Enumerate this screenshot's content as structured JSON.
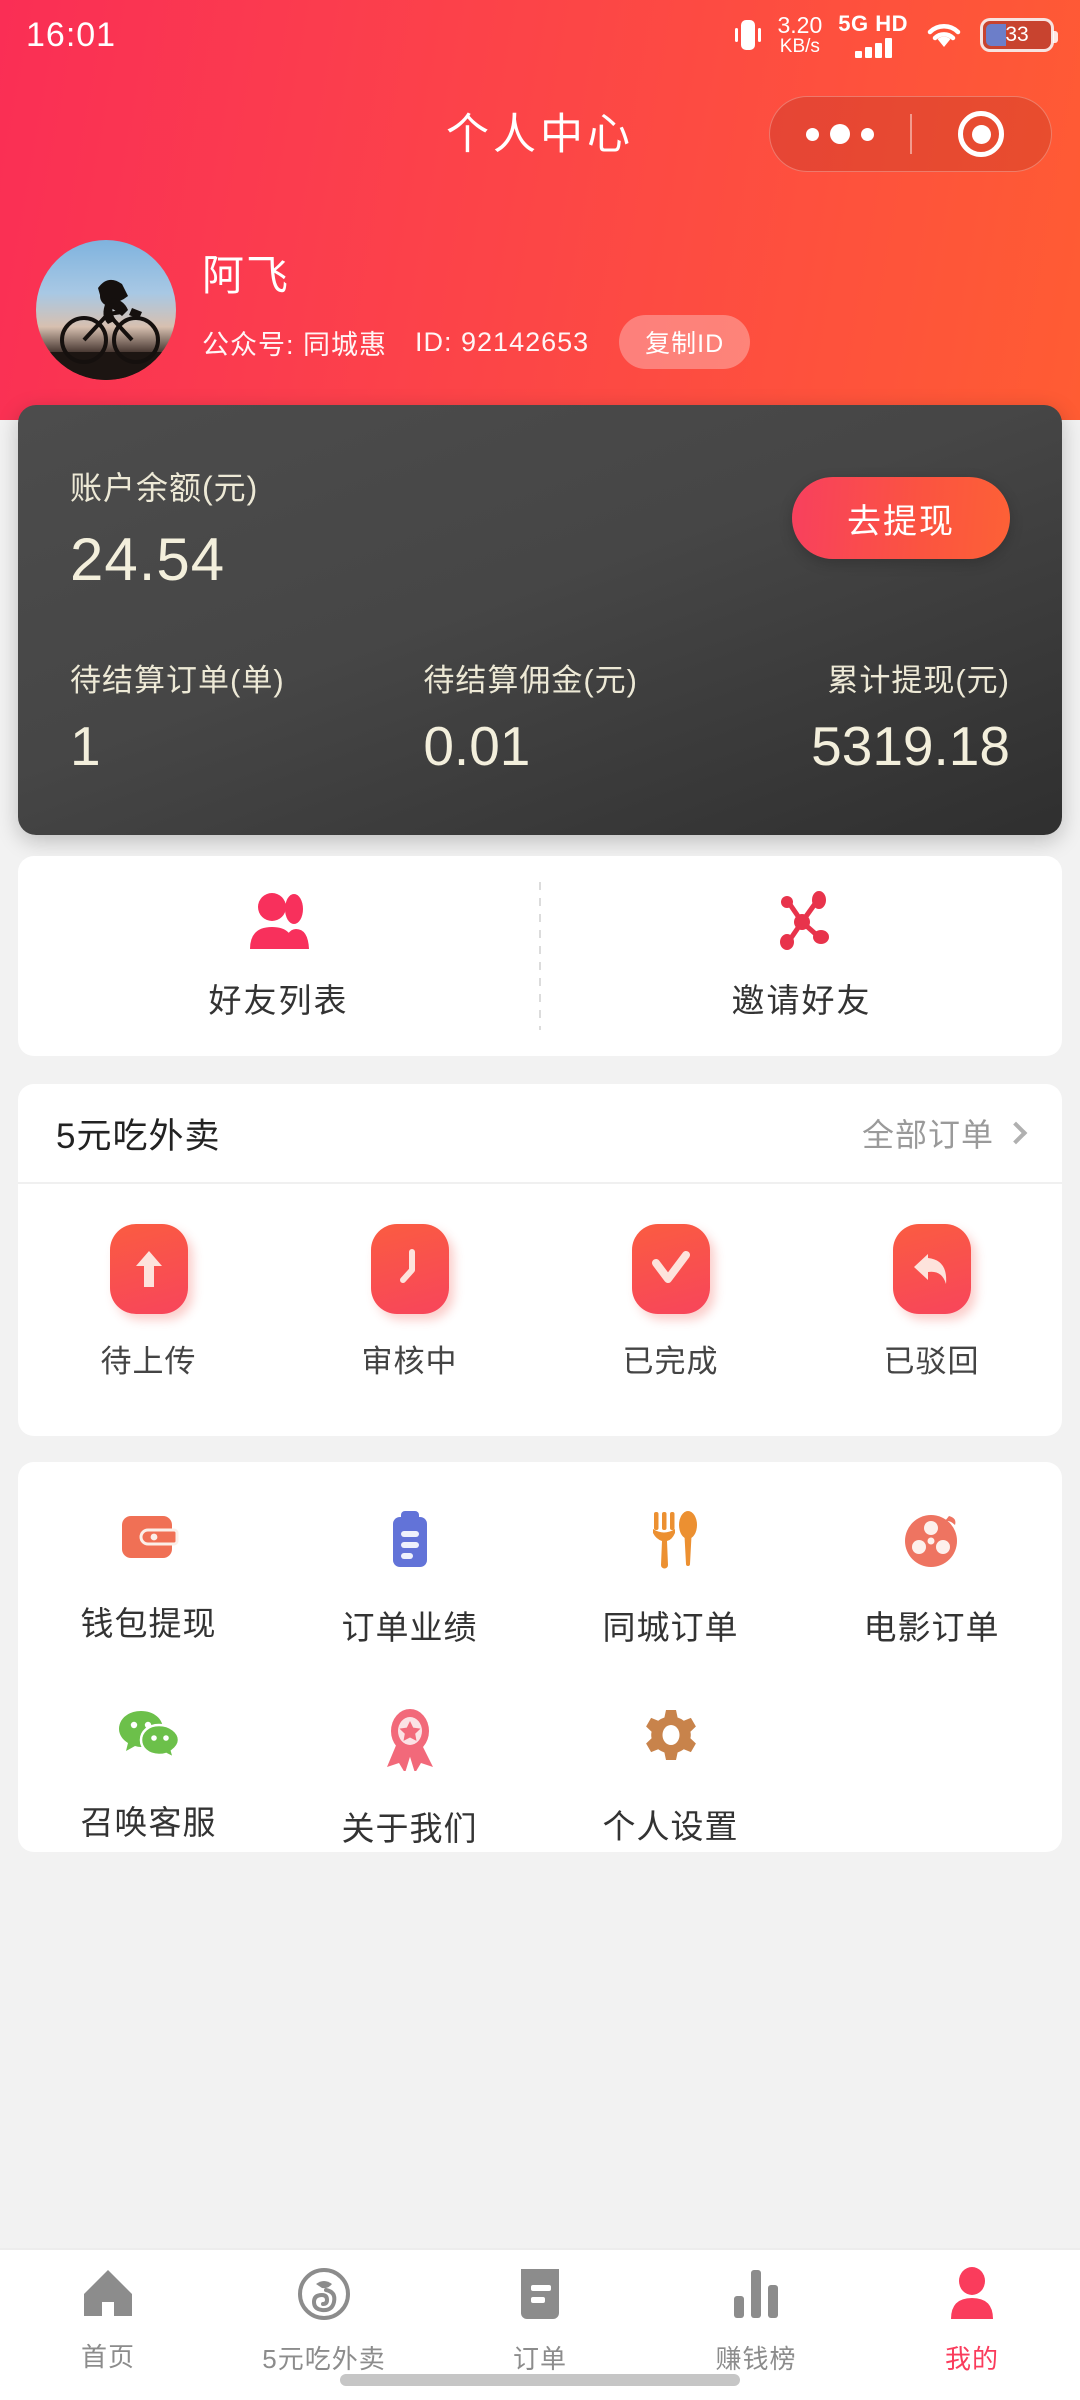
{
  "statusbar": {
    "time": "16:01",
    "net_speed_value": "3.20",
    "net_speed_unit": "KB/s",
    "network_label": "5G HD",
    "battery_percent": "33",
    "icons": [
      "vibrate-icon",
      "signal-icon",
      "wifi-icon",
      "battery-icon"
    ]
  },
  "navbar": {
    "title": "个人中心",
    "capsule": {
      "more_icon": "more-dots-icon",
      "target_icon": "target-icon"
    }
  },
  "profile": {
    "avatar_alt": "cyclist-avatar",
    "name": "阿飞",
    "account_label": "公众号: 同城惠",
    "id_label": "ID: 92142653",
    "copy_button": "复制ID"
  },
  "balance": {
    "label": "账户余额(元)",
    "value": "24.54",
    "withdraw_button": "去提现",
    "stats": [
      {
        "label": "待结算订单(单)",
        "value": "1"
      },
      {
        "label": "待结算佣金(元)",
        "value": "0.01"
      },
      {
        "label": "累计提现(元)",
        "value": "5319.18"
      }
    ]
  },
  "friends": {
    "items": [
      {
        "label": "好友列表",
        "icon": "friends-people-icon"
      },
      {
        "label": "邀请好友",
        "icon": "share-network-icon"
      }
    ]
  },
  "orders": {
    "title": "5元吃外卖",
    "more_label": "全部订单",
    "items": [
      {
        "label": "待上传",
        "icon": "upload-arrow-icon"
      },
      {
        "label": "审核中",
        "icon": "clock-icon"
      },
      {
        "label": "已完成",
        "icon": "check-icon"
      },
      {
        "label": "已驳回",
        "icon": "reply-arrow-icon"
      }
    ]
  },
  "menu": {
    "row1": [
      {
        "label": "钱包提现",
        "icon": "wallet-icon",
        "color": "#F07055"
      },
      {
        "label": "订单业绩",
        "icon": "clipboard-icon",
        "color": "#6273D8"
      },
      {
        "label": "同城订单",
        "icon": "fork-spoon-icon",
        "color": "#EC9031"
      },
      {
        "label": "电影订单",
        "icon": "film-reel-icon",
        "color": "#EE7461"
      }
    ],
    "row2": [
      {
        "label": "召唤客服",
        "icon": "wechat-icon",
        "color": "#6CC04A"
      },
      {
        "label": "关于我们",
        "icon": "medal-icon",
        "color": "#F2697A"
      },
      {
        "label": "个人设置",
        "icon": "gear-icon",
        "color": "#C8834B"
      }
    ]
  },
  "bottom_nav": {
    "items": [
      {
        "label": "首页",
        "icon": "home-icon",
        "active": false
      },
      {
        "label": "5元吃外卖",
        "icon": "takeout-logo-icon",
        "active": false
      },
      {
        "label": "订单",
        "icon": "order-doc-icon",
        "active": false
      },
      {
        "label": "赚钱榜",
        "icon": "bar-chart-icon",
        "active": false
      },
      {
        "label": "我的",
        "icon": "person-icon",
        "active": true
      }
    ]
  },
  "colors": {
    "header_start": "#FA2E55",
    "header_end": "#FF5C33",
    "accent": "#FA3C5C",
    "card_dark": "#464646",
    "page_bg": "#F2F2F2"
  }
}
